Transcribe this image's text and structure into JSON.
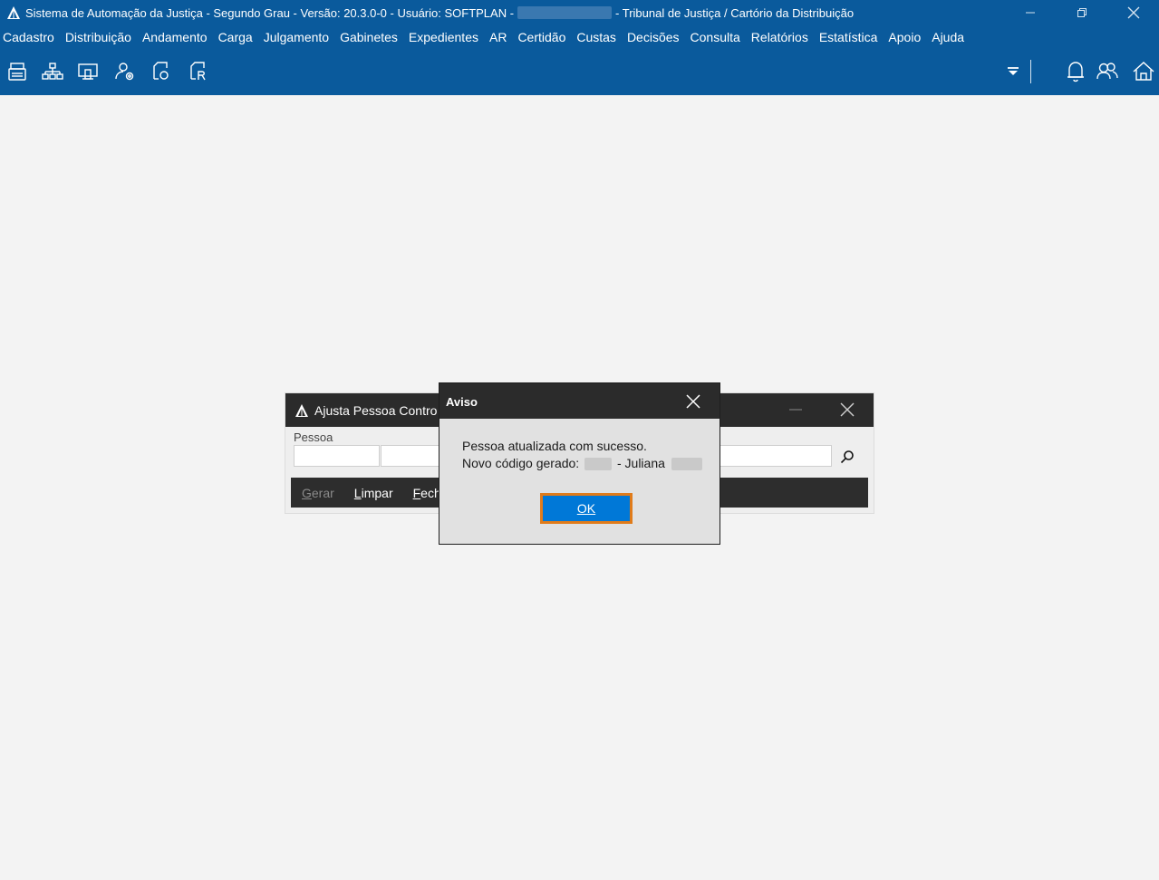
{
  "titlebar": {
    "title_main": "Sistema de Automação da Justiça - Segundo Grau - Versão: 20.3.0-0 - Usuário: SOFTPLAN -",
    "title_rest": "- Tribunal de Justiça / Cartório da Distribuição"
  },
  "menubar": {
    "items": [
      "Cadastro",
      "Distribuição",
      "Andamento",
      "Carga",
      "Julgamento",
      "Gabinetes",
      "Expedientes",
      "AR",
      "Certidão",
      "Custas",
      "Decisões",
      "Consulta",
      "Relatórios",
      "Estatística",
      "Apoio",
      "Ajuda"
    ]
  },
  "toolbar": {
    "icons": [
      "printer-icon",
      "org-chart-icon",
      "screen-icon",
      "user-settings-icon",
      "document-o-icon",
      "document-r-icon",
      "filter-icon",
      "bell-icon",
      "users-icon",
      "home-icon"
    ],
    "icon_color": "#ffffff"
  },
  "bg_window": {
    "title": "Ajusta Pessoa Contro",
    "pessoa_label": "Pessoa",
    "buttons": {
      "gerar_mnemonic": "G",
      "gerar_rest": "erar",
      "limpar_mnemonic": "L",
      "limpar_rest": "impar",
      "fechar_mnemonic": "F",
      "fechar_rest": "ech"
    }
  },
  "dialog": {
    "title": "Aviso",
    "message_line1": "Pessoa atualizada com sucesso.",
    "message_line2_prefix": "Novo código gerado:",
    "message_line2_name": "- Juliana",
    "ok_mnemonic": "O",
    "ok_rest": "K"
  },
  "colors": {
    "brand_blue": "#0a5a9c",
    "dialog_button_blue": "#0078d7",
    "focus_orange": "#e07b1a",
    "dark_title": "#2b2b2b"
  }
}
